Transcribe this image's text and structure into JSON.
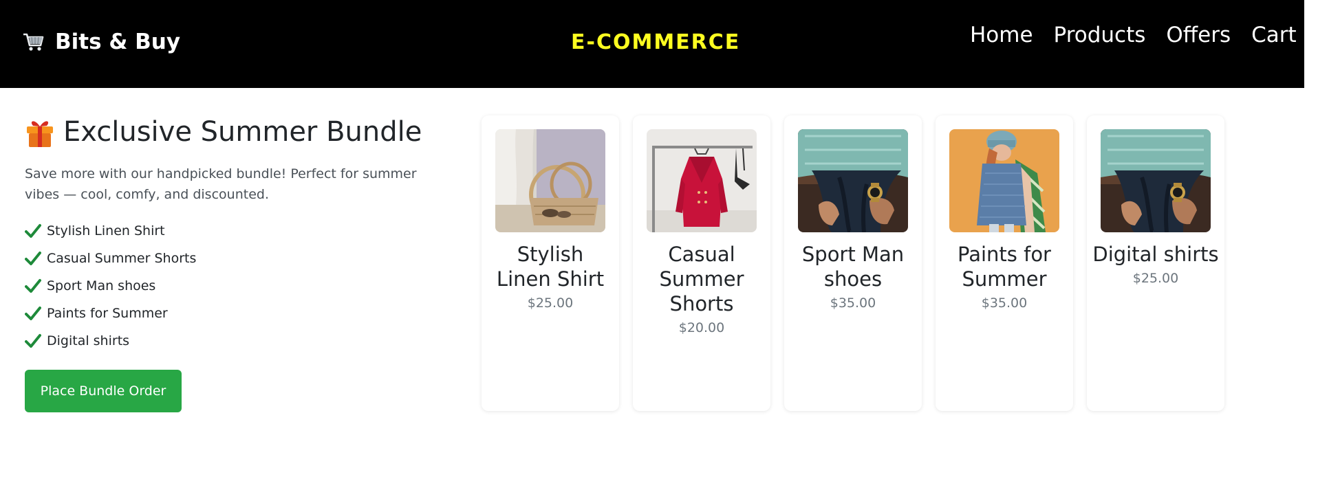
{
  "header": {
    "brand": "Bits & Buy",
    "center_title": "E-COMMERCE",
    "nav": [
      "Home",
      "Products",
      "Offers",
      "Cart"
    ]
  },
  "bundle": {
    "title": "Exclusive Summer Bundle",
    "description": "Save more with our handpicked bundle! Perfect for summer vibes — cool, comfy, and discounted.",
    "items": [
      "Stylish Linen Shirt",
      "Casual Summer Shorts",
      "Sport Man shoes",
      "Paints for Summer",
      "Digital shirts"
    ],
    "button_label": "Place Bundle Order"
  },
  "products": [
    {
      "name": "Stylish Linen Shirt",
      "price": "$25.00",
      "image": "straw-bag-photo"
    },
    {
      "name": "Casual Summer Shorts",
      "price": "$20.00",
      "image": "red-coat-photo"
    },
    {
      "name": "Sport Man shoes",
      "price": "$35.00",
      "image": "watch-photo"
    },
    {
      "name": "Paints for Summer",
      "price": "$35.00",
      "image": "sweater-photo"
    },
    {
      "name": "Digital shirts",
      "price": "$25.00",
      "image": "watch-photo"
    }
  ],
  "colors": {
    "navbar": "#000000",
    "center_title": "#ffff20",
    "button": "#28a745",
    "check": "#1e8a3a"
  }
}
